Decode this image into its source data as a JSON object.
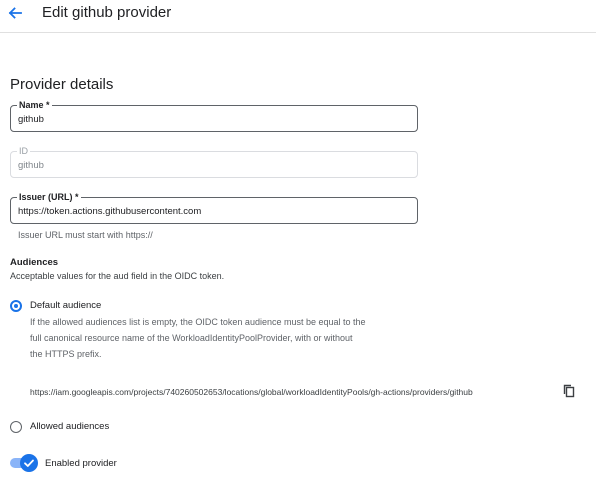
{
  "header": {
    "title": "Edit github provider",
    "back_icon": "arrow-back-icon"
  },
  "section": {
    "title": "Provider details"
  },
  "fields": {
    "name": {
      "label": "Name *",
      "value": "github"
    },
    "id": {
      "label": "ID",
      "value": "github"
    },
    "issuer": {
      "label": "Issuer (URL) *",
      "value": "https://token.actions.githubusercontent.com",
      "hint": "Issuer URL must start with https://"
    }
  },
  "audiences": {
    "title": "Audiences",
    "subtitle": "Acceptable values for the aud field in the OIDC token.",
    "default": {
      "label": "Default audience",
      "selected": true,
      "description_lines": [
        "If the allowed audiences list is empty, the OIDC token audience must be equal to the",
        "full canonical resource name of the WorkloadIdentityPoolProvider, with or without",
        "the HTTPS prefix."
      ],
      "url": "https://iam.googleapis.com/projects/740260502653/locations/global/workloadIdentityPools/gh-actions/providers/github",
      "copy_icon": "copy-icon"
    },
    "allowed": {
      "label": "Allowed audiences",
      "selected": false
    }
  },
  "enabled": {
    "label": "Enabled provider",
    "checked": true
  },
  "colors": {
    "accent": "#1a73e8",
    "border": "#9aa0a6",
    "hint": "#5f6368"
  }
}
